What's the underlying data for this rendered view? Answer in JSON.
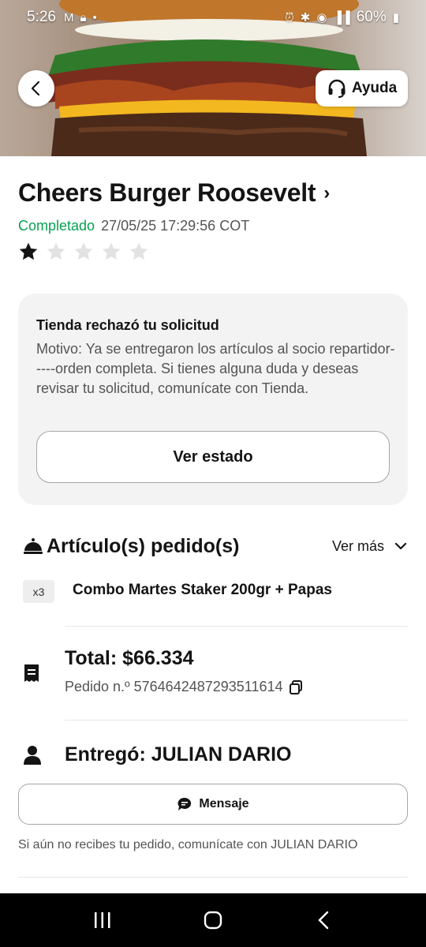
{
  "status_bar": {
    "time": "5:26",
    "battery": "60%"
  },
  "header": {
    "help_label": "Ayuda"
  },
  "store": {
    "name": "Cheers Burger Roosevelt",
    "status": "Completado",
    "datetime": "27/05/25 17:29:56 COT",
    "rating": 1,
    "rating_max": 5
  },
  "notice": {
    "title": "Tienda rechazó tu solicitud",
    "body": "Motivo: Ya se entregaron los artículos al socio repartidor-----orden completa. Si tienes alguna duda y deseas revisar tu solicitud, comunícate con Tienda.",
    "button_label": "Ver estado"
  },
  "items": {
    "title": "Artículo(s) pedido(s)",
    "more_label": "Ver más",
    "list": [
      {
        "qty": "x3",
        "name": "Combo Martes Staker 200gr + Papas"
      }
    ]
  },
  "order": {
    "total": "Total: $66.334",
    "number": "Pedido n.º 5764642487293511614"
  },
  "delivery": {
    "delivered_by": "Entregó: JULIAN DARIO",
    "message_label": "Mensaje",
    "hint": "Si aún no recibes tu pedido, comunícate con JULIAN DARIO"
  },
  "colors": {
    "status_green": "#06a250",
    "star_filled": "#141414",
    "star_empty": "#e2e2e2"
  }
}
